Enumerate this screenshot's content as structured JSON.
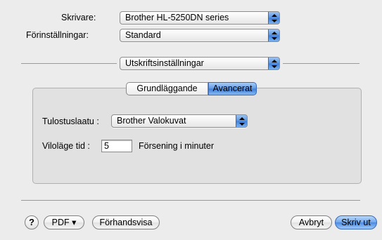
{
  "printer": {
    "label": "Skrivare:",
    "value": "Brother HL-5250DN series"
  },
  "presets": {
    "label": "Förinställningar:",
    "value": "Standard"
  },
  "pane": {
    "value": "Utskriftsinställningar"
  },
  "tabs": [
    {
      "label": "Grundläggande",
      "selected": false
    },
    {
      "label": "Avancerat",
      "selected": true
    }
  ],
  "settings": {
    "quality_label": "Tulostuslaatu :",
    "quality_value": "Brother Valokuvat",
    "sleep_label": "Viloläge tid :",
    "sleep_value": "5",
    "sleep_unit": "Försening i minuter"
  },
  "footer": {
    "help": "?",
    "pdf": "PDF ▾",
    "preview": "Förhandsvisa",
    "cancel": "Avbryt",
    "print": "Skriv ut"
  },
  "colors": {
    "accent": "#4a8ae3",
    "background": "#ececec"
  }
}
